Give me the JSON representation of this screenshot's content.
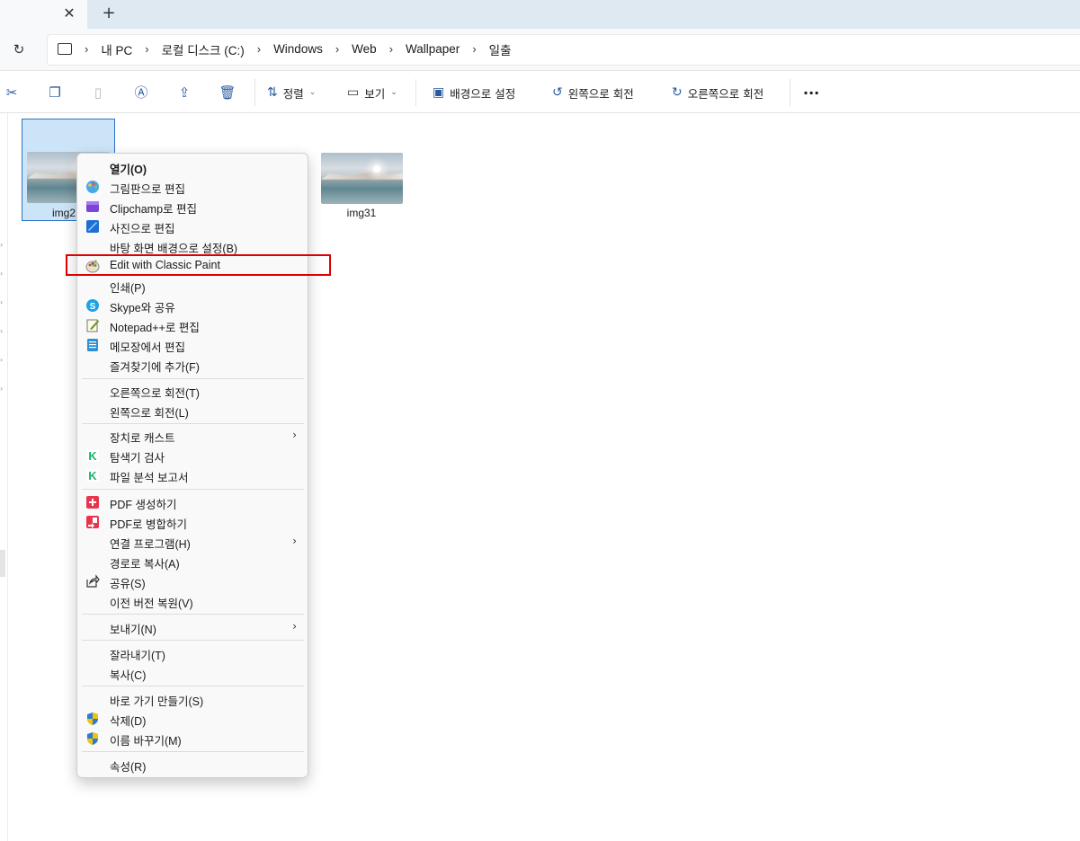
{
  "tabs": {
    "close_glyph": "✕",
    "new_glyph": "+"
  },
  "address_bar": {
    "refresh_glyph": "↻",
    "breadcrumbs": [
      "내 PC",
      "로컬 디스크 (C:)",
      "Windows",
      "Web",
      "Wallpaper",
      "일출"
    ]
  },
  "toolbar": {
    "sort_label": "정렬",
    "view_label": "보기",
    "set_bg_label": "배경으로 설정",
    "rotate_left_label": "왼쪽으로 회전",
    "rotate_right_label": "오른쪽으로 회전",
    "more_label": "···"
  },
  "files": [
    {
      "name": "img2"
    },
    {
      "name": "img31"
    }
  ],
  "context_menu": {
    "items": [
      {
        "label": "열기(O)",
        "bold": true,
        "icon": "none"
      },
      {
        "label": "그림판으로 편집",
        "icon": "paint-icon"
      },
      {
        "label": "Clipchamp로 편집",
        "icon": "clipchamp-icon"
      },
      {
        "label": "사진으로 편집",
        "icon": "photos-icon"
      },
      {
        "label": "바탕 화면 배경으로 설정(B)",
        "icon": "none"
      },
      {
        "label": "Edit with Classic Paint",
        "icon": "classic-paint-icon",
        "highlighted": true
      },
      {
        "label": "인쇄(P)",
        "icon": "none"
      },
      {
        "label": "Skype와 공유",
        "icon": "skype-icon"
      },
      {
        "label": "Notepad++로 편집",
        "icon": "notepadpp-icon"
      },
      {
        "label": "메모장에서 편집",
        "icon": "notepad-icon"
      },
      {
        "label": "즐겨찾기에 추가(F)",
        "icon": "none"
      },
      {
        "label": "오른쪽으로 회전(T)",
        "icon": "none"
      },
      {
        "label": "왼쪽으로 회전(L)",
        "icon": "none"
      },
      {
        "label": "장치로 캐스트",
        "icon": "none",
        "submenu": true
      },
      {
        "label": "탐색기 검사",
        "icon": "kaspersky-icon"
      },
      {
        "label": "파일 분석 보고서",
        "icon": "kaspersky-icon"
      },
      {
        "label": "PDF 생성하기",
        "icon": "pdf-create-icon"
      },
      {
        "label": "PDF로 병합하기",
        "icon": "pdf-merge-icon"
      },
      {
        "label": "연결 프로그램(H)",
        "icon": "none",
        "submenu": true
      },
      {
        "label": "경로로 복사(A)",
        "icon": "none"
      },
      {
        "label": "공유(S)",
        "icon": "share-icon"
      },
      {
        "label": "이전 버전 복원(V)",
        "icon": "none"
      },
      {
        "label": "보내기(N)",
        "icon": "none",
        "submenu": true
      },
      {
        "label": "잘라내기(T)",
        "icon": "none"
      },
      {
        "label": "복사(C)",
        "icon": "none"
      },
      {
        "label": "바로 가기 만들기(S)",
        "icon": "none"
      },
      {
        "label": "삭제(D)",
        "icon": "shield-icon"
      },
      {
        "label": "이름 바꾸기(M)",
        "icon": "shield-icon"
      },
      {
        "label": "속성(R)",
        "icon": "none"
      }
    ],
    "submenu_glyph": "›"
  },
  "colors": {
    "accent": "#2a73c8",
    "selection": "#cce4f7",
    "highlight_box": "#e00000"
  }
}
